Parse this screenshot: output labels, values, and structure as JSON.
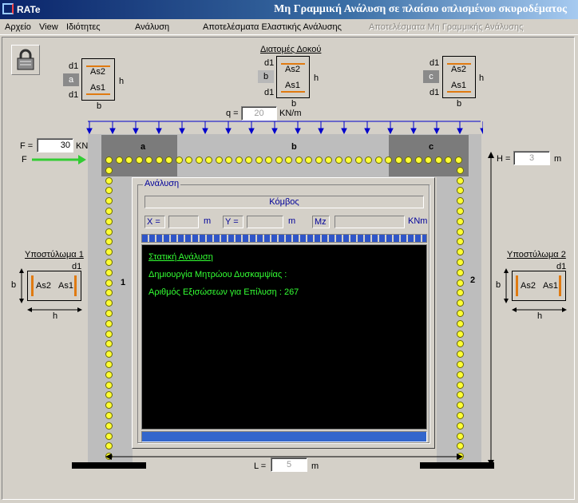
{
  "app": {
    "name": "RATe",
    "window_title": "Μη Γραμμική Ανάλυση σε πλαίσιο οπλισμένου σκυροδέματος"
  },
  "menu": [
    {
      "label": "Αρχείο",
      "enabled": true
    },
    {
      "label": "View",
      "enabled": true
    },
    {
      "label": "Ιδιότητες",
      "enabled": true
    },
    {
      "label": "Ανάλυση",
      "enabled": true
    },
    {
      "label": "Αποτελέσματα Ελαστικής Ανάλυσης",
      "enabled": true
    },
    {
      "label": "Αποτελέσματα Μη Γραμμικής Ανάλυσης",
      "enabled": false
    }
  ],
  "beam_sections": {
    "title": "Διατομές Δοκού",
    "d1": "d1",
    "as2": "As2",
    "as1": "As1",
    "h": "h",
    "b": "b",
    "tags": [
      "a",
      "b",
      "c"
    ]
  },
  "load": {
    "q_label": "q =",
    "q_value": "20",
    "q_unit": "KN/m"
  },
  "force": {
    "label": "F =",
    "value": "30",
    "unit": "KN",
    "arrow_label": "F"
  },
  "height": {
    "label": "H =",
    "value": "3",
    "unit": "m"
  },
  "length": {
    "label": "L =",
    "value": "5",
    "unit": "m"
  },
  "frame": {
    "zone_a": "a",
    "zone_b": "b",
    "zone_c": "c",
    "col1_num": "1",
    "col2_num": "2"
  },
  "columns": {
    "col1_title": "Υποστύλωμα 1",
    "col2_title": "Υποστύλωμα 2",
    "d1": "d1",
    "b": "b",
    "h": "h",
    "as2": "As2",
    "as1": "As1"
  },
  "analysis": {
    "group_title": "Ανάλυση",
    "node_label": "Κόμβος",
    "x_label": "X =",
    "y_label": "Y =",
    "mz_label": "Mz",
    "x_unit": "m",
    "y_unit": "m",
    "mz_unit": "KNm",
    "console": {
      "heading": "Στατική Ανάλυση",
      "line1": "Δημιουργία Μητρώου Δυσκαμψίας :",
      "line2": "Αριθμός Εξισώσεων για Επίλυση   : 267"
    }
  },
  "colors": {
    "accent": "#0a246a",
    "load_arrow": "#0000cc",
    "force_arrow": "#33cc33",
    "node": "#ffff33",
    "rebar": "#e07a10",
    "console_text": "#33ff33"
  }
}
